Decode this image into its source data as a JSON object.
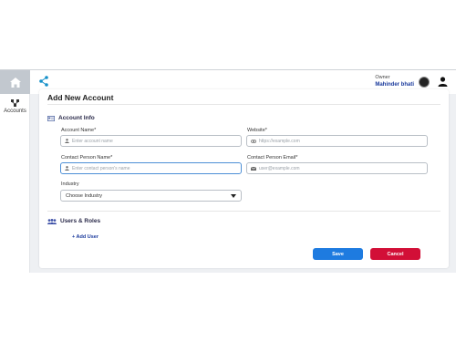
{
  "sidebar": {
    "home_icon": "home-icon",
    "items": [
      {
        "label": "Accounts",
        "icon": "accounts-icon"
      }
    ]
  },
  "header": {
    "share_icon": "share-icon",
    "owner_role": "Owner",
    "owner_name": "Mahinder bhati",
    "user_icon": "user-icon"
  },
  "form": {
    "title": "Add New Account",
    "account_info": {
      "heading": "Account Info",
      "account_name": {
        "label": "Account Name*",
        "placeholder": "Enter account name"
      },
      "website": {
        "label": "Website*",
        "placeholder": "https://example.com"
      },
      "contact_person_name": {
        "label": "Contact Person Name*",
        "placeholder": "Enter contact person's name"
      },
      "contact_person_email": {
        "label": "Contact Person Email*",
        "placeholder": "user@example.com"
      },
      "industry": {
        "label": "Industry",
        "selected": "Choose Industry"
      }
    },
    "users_roles": {
      "heading": "Users & Roles",
      "add_user": "+ Add User"
    },
    "save_label": "Save",
    "cancel_label": "Cancel"
  },
  "colors": {
    "accent": "#1e7be0",
    "danger": "#d20f37",
    "link": "#1a3a9c"
  }
}
